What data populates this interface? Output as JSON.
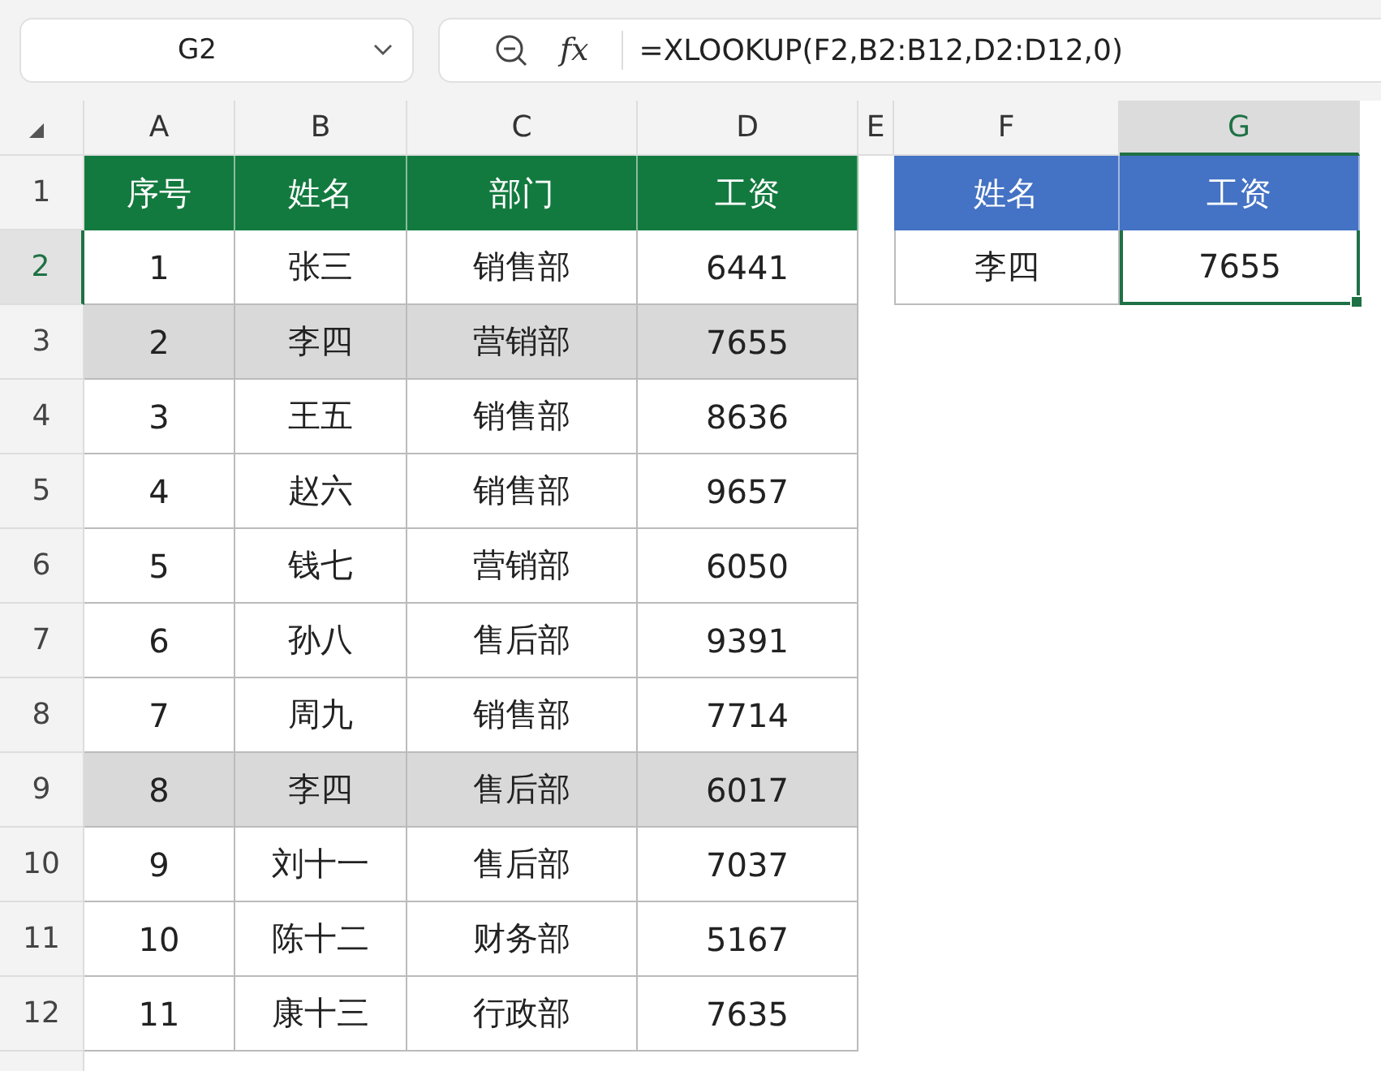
{
  "name_box": "G2",
  "function_label": "fx",
  "formula": "=XLOOKUP(F2,B2:B12,D2:D12,0)",
  "column_headers": [
    {
      "label": "A",
      "selected": false
    },
    {
      "label": "B",
      "selected": false
    },
    {
      "label": "C",
      "selected": false
    },
    {
      "label": "D",
      "selected": false
    },
    {
      "label": "E",
      "selected": false
    },
    {
      "label": "F",
      "selected": false
    },
    {
      "label": "G",
      "selected": true
    }
  ],
  "row_headers": [
    {
      "label": "1",
      "selected": false
    },
    {
      "label": "2",
      "selected": true
    },
    {
      "label": "3",
      "selected": false
    },
    {
      "label": "4",
      "selected": false
    },
    {
      "label": "5",
      "selected": false
    },
    {
      "label": "6",
      "selected": false
    },
    {
      "label": "7",
      "selected": false
    },
    {
      "label": "8",
      "selected": false
    },
    {
      "label": "9",
      "selected": false
    },
    {
      "label": "10",
      "selected": false
    },
    {
      "label": "11",
      "selected": false
    },
    {
      "label": "12",
      "selected": false
    }
  ],
  "table": {
    "columns": [
      "序号",
      "姓名",
      "部门",
      "工资"
    ],
    "rows": [
      {
        "cells": [
          "1",
          "张三",
          "销售部",
          "6441"
        ],
        "highlighted": false
      },
      {
        "cells": [
          "2",
          "李四",
          "营销部",
          "7655"
        ],
        "highlighted": true
      },
      {
        "cells": [
          "3",
          "王五",
          "销售部",
          "8636"
        ],
        "highlighted": false
      },
      {
        "cells": [
          "4",
          "赵六",
          "销售部",
          "9657"
        ],
        "highlighted": false
      },
      {
        "cells": [
          "5",
          "钱七",
          "营销部",
          "6050"
        ],
        "highlighted": false
      },
      {
        "cells": [
          "6",
          "孙八",
          "售后部",
          "9391"
        ],
        "highlighted": false
      },
      {
        "cells": [
          "7",
          "周九",
          "销售部",
          "7714"
        ],
        "highlighted": false
      },
      {
        "cells": [
          "8",
          "李四",
          "售后部",
          "6017"
        ],
        "highlighted": true
      },
      {
        "cells": [
          "9",
          "刘十一",
          "售后部",
          "7037"
        ],
        "highlighted": false
      },
      {
        "cells": [
          "10",
          "陈十二",
          "财务部",
          "5167"
        ],
        "highlighted": false
      },
      {
        "cells": [
          "11",
          "康十三",
          "行政部",
          "7635"
        ],
        "highlighted": false
      }
    ]
  },
  "lookup": {
    "columns": [
      "姓名",
      "工资"
    ],
    "cells": [
      {
        "value": "李四",
        "selected": false
      },
      {
        "value": "7655",
        "selected": true
      }
    ]
  }
}
